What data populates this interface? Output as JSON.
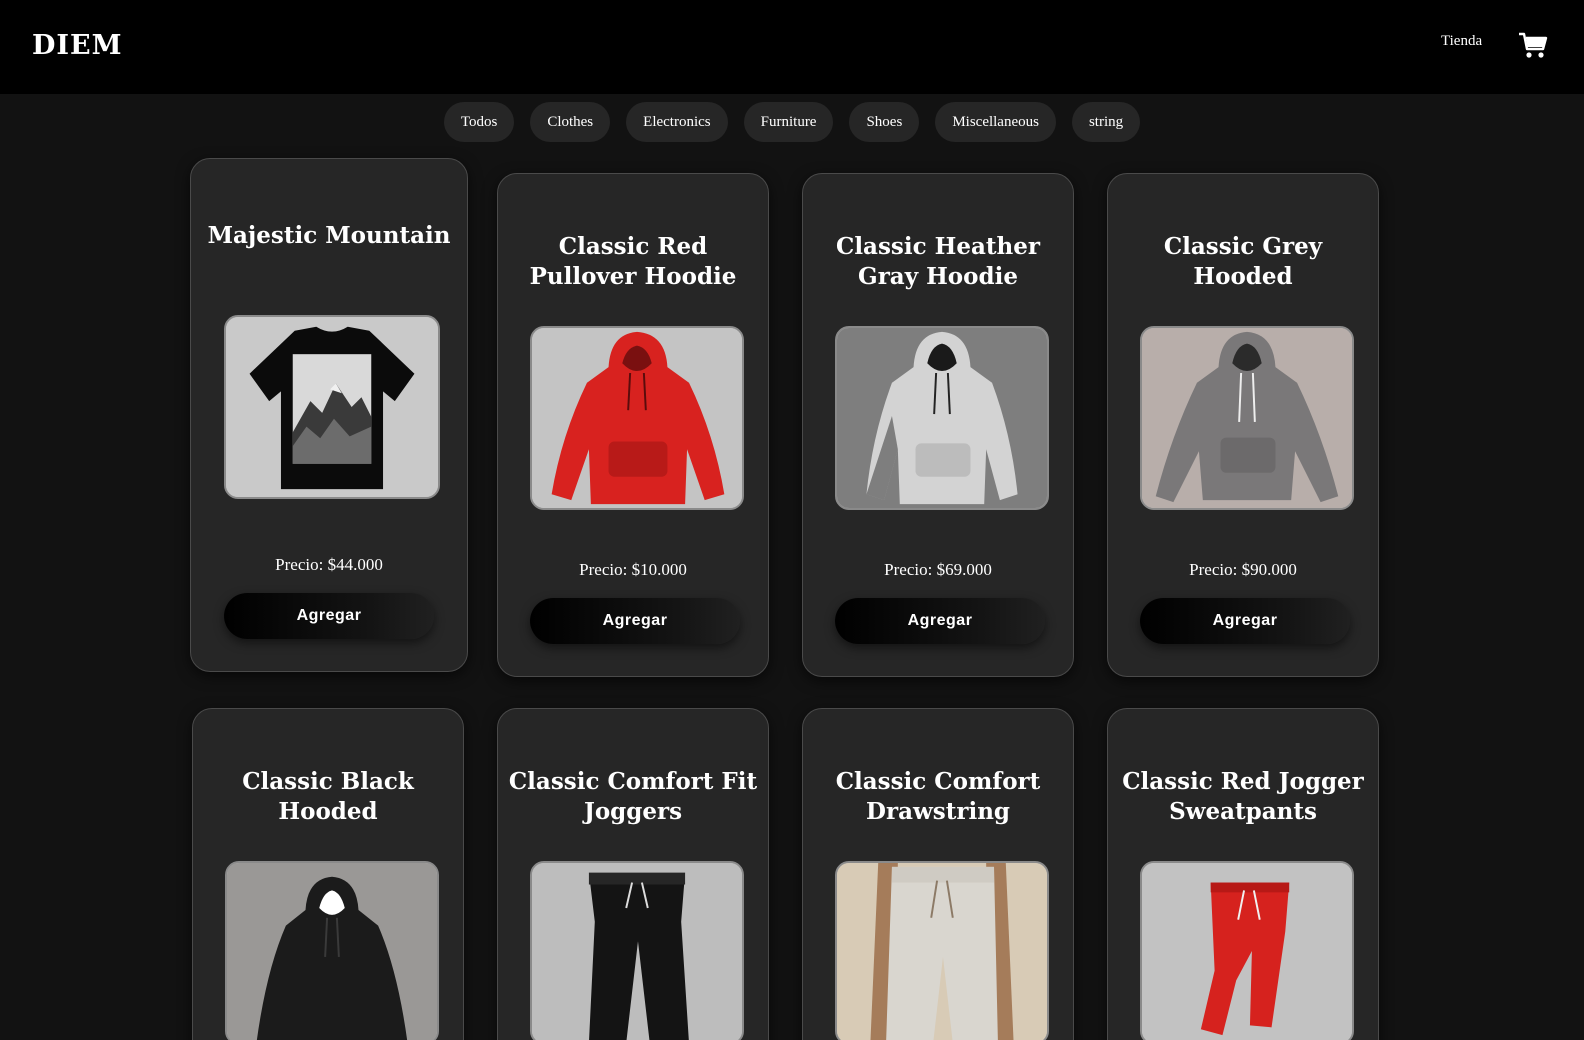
{
  "header": {
    "brand": "DIEM",
    "nav_link": "Tienda",
    "cart_icon": "shopping-cart-icon"
  },
  "categories": [
    "Todos",
    "Clothes",
    "Electronics",
    "Furniture",
    "Shoes",
    "Miscellaneous",
    "string"
  ],
  "products": [
    {
      "title": "Majestic Mountain",
      "price": "Precio: $44.000",
      "button": "Agregar",
      "image": "black-tshirt-mountain-print"
    },
    {
      "title": "Classic Red Pullover Hoodie",
      "price": "Precio: $10.000",
      "button": "Agregar",
      "image": "red-hoodie"
    },
    {
      "title": "Classic Heather Gray Hoodie",
      "price": "Precio: $69.000",
      "button": "Agregar",
      "image": "heather-gray-hoodie"
    },
    {
      "title": "Classic Grey Hooded",
      "price": "Precio: $90.000",
      "button": "Agregar",
      "image": "grey-hoodie"
    },
    {
      "title": "Classic Black Hooded",
      "price": "",
      "button": "",
      "image": "black-hoodie"
    },
    {
      "title": "Classic Comfort Fit Joggers",
      "price": "",
      "button": "",
      "image": "black-joggers"
    },
    {
      "title": "Classic Comfort Drawstring",
      "price": "",
      "button": "",
      "image": "cream-joggers"
    },
    {
      "title": "Classic Red Jogger Sweatpants",
      "price": "",
      "button": "",
      "image": "red-joggers"
    }
  ],
  "colors": {
    "background": "#121212",
    "header": "#000000",
    "card": "#262626",
    "pill": "#262626"
  }
}
